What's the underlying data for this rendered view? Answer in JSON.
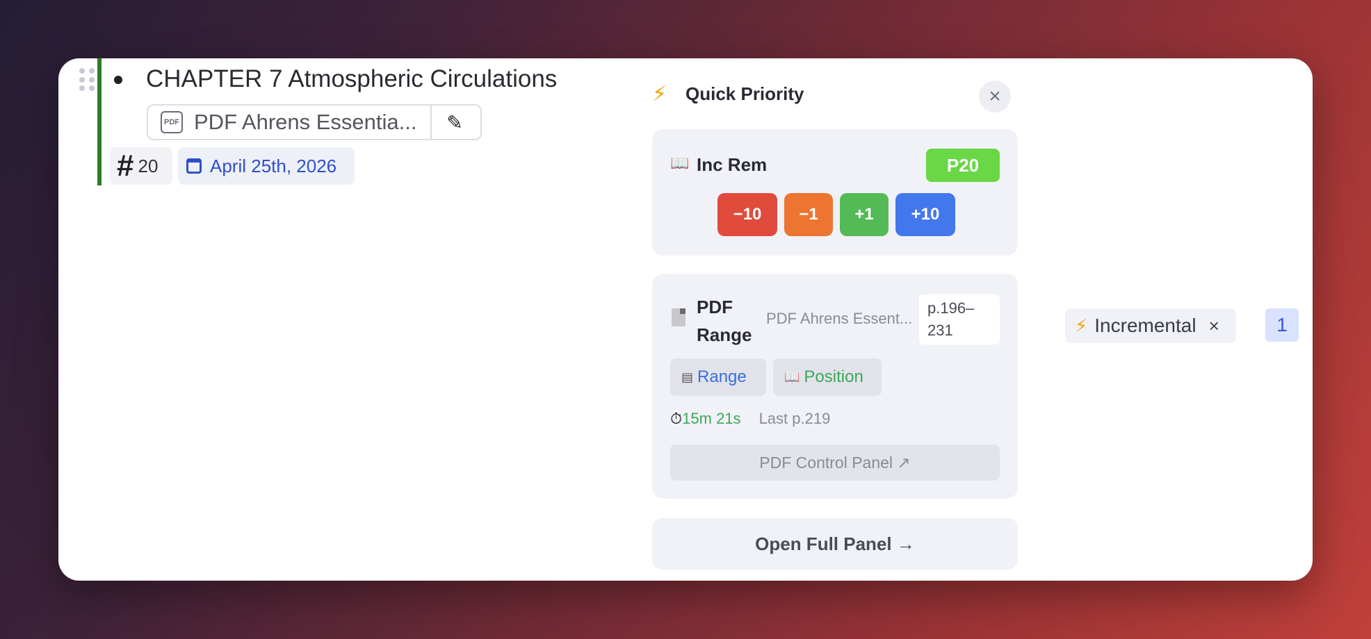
{
  "document": {
    "title": "CHAPTER 7 Atmospheric Circulations",
    "pdf_label": "PDF",
    "pdf_name": "PDF Ahrens Essentia...",
    "tag_count": "20",
    "date": "April 25th, 2026"
  },
  "quick_priority": {
    "title": "Quick Priority",
    "inc_rem": {
      "label": "Inc Rem",
      "priority": "P20",
      "buttons": [
        "−10",
        "−1",
        "+1",
        "+10"
      ]
    },
    "pdf_range": {
      "title": "PDF Range",
      "doc_name": "PDF Ahrens Essent...",
      "pages": "p.196–231",
      "tabs": {
        "range": "Range",
        "position": "Position"
      },
      "time": "15m 21s",
      "last_page": "Last p.219",
      "control_panel": "PDF Control Panel ↗"
    },
    "open_full": "Open Full Panel →"
  },
  "side": {
    "incremental_label": "Incremental",
    "count": "1"
  },
  "colors": {
    "priority_badge": "#6ad746",
    "minus10": "#e04b3c",
    "minus1": "#eb7531",
    "plus1": "#53ba56",
    "plus10": "#4378ec",
    "accent_bar": "#2e7d22"
  }
}
